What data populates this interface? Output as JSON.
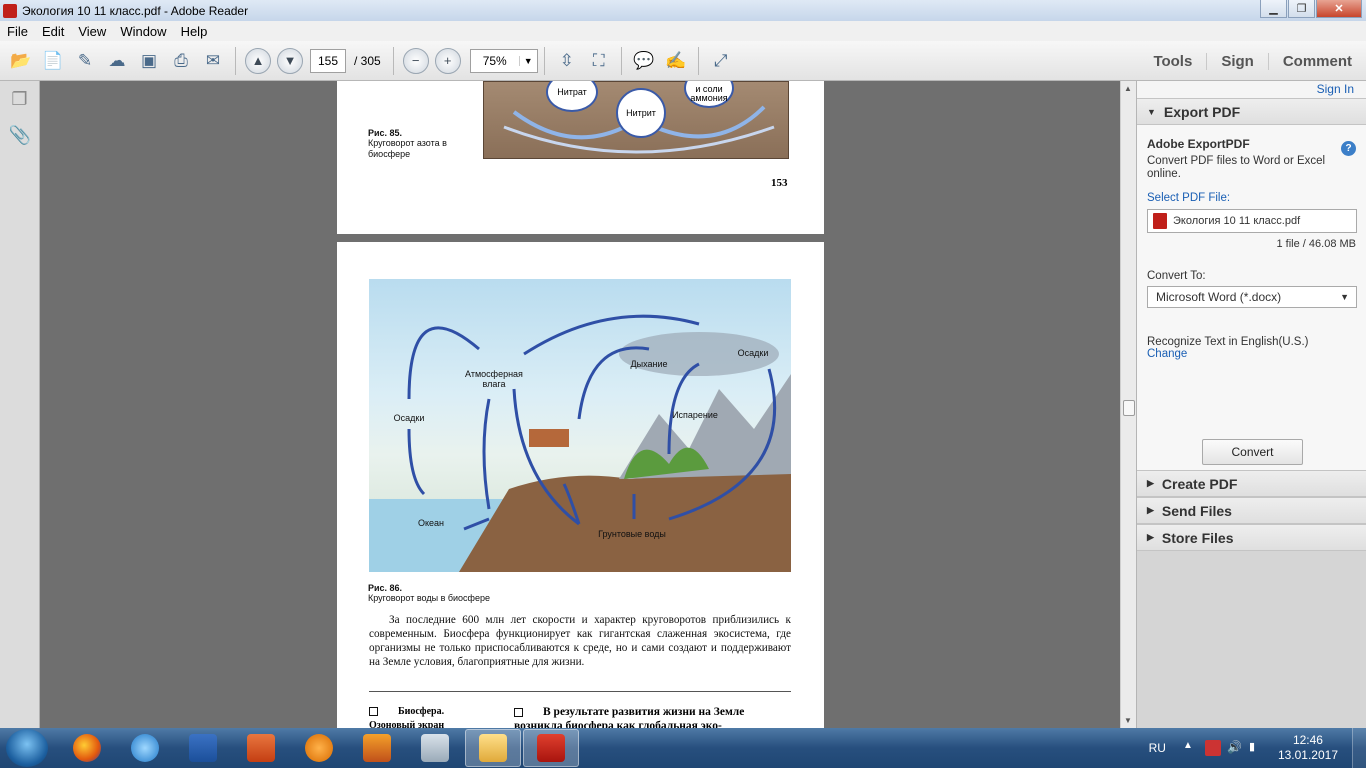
{
  "window": {
    "title": "Экология 10 11 класс.pdf - Adobe Reader"
  },
  "menu": [
    "File",
    "Edit",
    "View",
    "Window",
    "Help"
  ],
  "toolbar": {
    "page_current": "155",
    "page_total": "/ 305",
    "zoom": "75%",
    "right": {
      "tools": "Tools",
      "sign": "Sign",
      "comment": "Comment"
    }
  },
  "page1": {
    "nodes": [
      "Нитрат",
      "Нитрит",
      "и соли аммония"
    ],
    "caption_fig": "Рис. 85.",
    "caption_text": "Круговорот азота в биосфере",
    "page_number": "153"
  },
  "page2": {
    "labels": {
      "atmo": "Атмосферная влага",
      "precip_left": "Осадки",
      "breath": "Дыхание",
      "precip_right": "Осадки",
      "evap": "Испарение",
      "ocean": "Океан",
      "ground": "Грунтовые воды"
    },
    "caption_fig": "Рис. 86.",
    "caption_text": "Круговорот воды в биосфере",
    "paragraph": "За последние 600 млн лет скорости и характер круговоротов приблизились к современным. Биосфера функционирует как гигантская слаженная экосистема, где организмы не только приспосабливаются к среде, но и сами создают и поддерживают на Земле условия, благоприятные для жизни.",
    "bottom_left": "Биосфера. Озоновый экран",
    "bottom_right": "В результате развития жизни на Земле возникла биосфера как глобальная эко-"
  },
  "right_panel": {
    "sign_in": "Sign In",
    "export_head": "Export PDF",
    "export_title": "Adobe ExportPDF",
    "export_desc": "Convert PDF files to Word or Excel online.",
    "select_label": "Select PDF File:",
    "file_name": "Экология 10 11 класс.pdf",
    "file_meta": "1 file / 46.08 MB",
    "convert_to_label": "Convert To:",
    "convert_to_value": "Microsoft Word (*.docx)",
    "recognize": "Recognize Text in English(U.S.)",
    "change": "Change",
    "convert_btn": "Convert",
    "sections": [
      "Create PDF",
      "Send Files",
      "Store Files"
    ]
  },
  "taskbar": {
    "lang": "RU",
    "time": "12:46",
    "date": "13.01.2017"
  }
}
